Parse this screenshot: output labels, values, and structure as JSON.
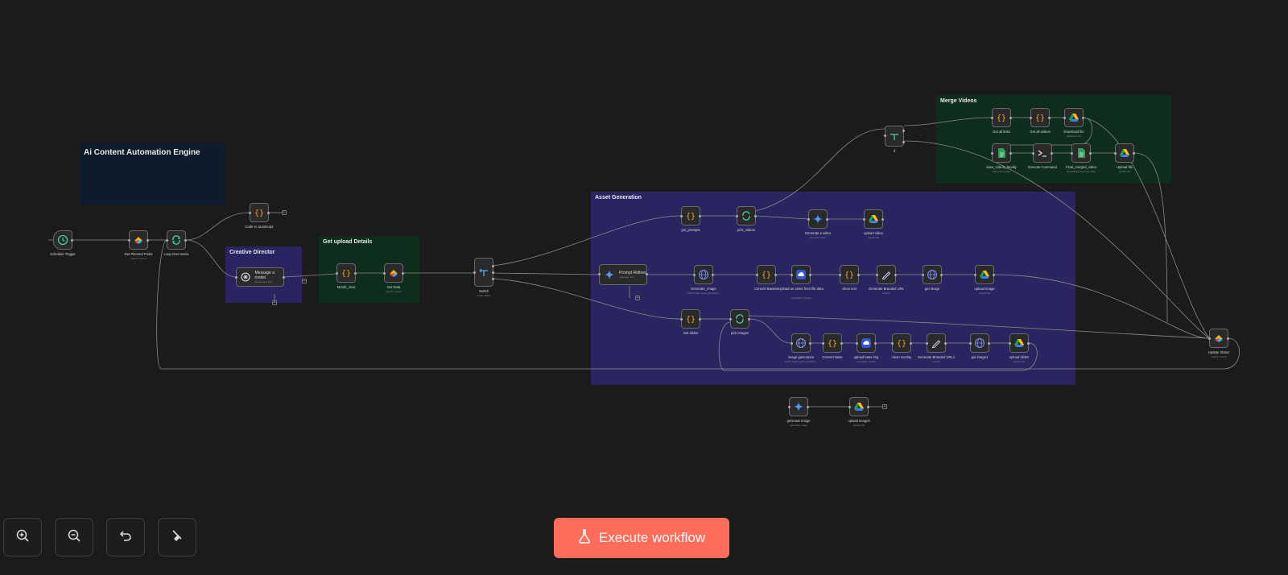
{
  "canvas": {
    "background": "#1b1b1b",
    "execute_label": "Execute workflow",
    "execute_color": "#ff6d5a"
  },
  "controls": [
    {
      "name": "zoom-in-button",
      "icon": "zoom-in-icon"
    },
    {
      "name": "zoom-out-button",
      "icon": "zoom-out-icon"
    },
    {
      "name": "undo-button",
      "icon": "undo-icon"
    },
    {
      "name": "tidy-up-button",
      "icon": "broom-icon"
    }
  ],
  "sticky_notes": [
    {
      "id": "engine",
      "title": "Ai Content Automation Engine",
      "color": "#0d1b2a"
    },
    {
      "id": "creative",
      "title": "Creative Director",
      "color": "#2a2560"
    },
    {
      "id": "upload",
      "title": "Get upload Details",
      "color": "#0f2d1c"
    },
    {
      "id": "asset",
      "title": "Asset Generation",
      "color": "#2a2560"
    },
    {
      "id": "merge",
      "title": "Merge Videos",
      "color": "#0f2d1c"
    }
  ],
  "nodes": [
    {
      "id": "trigger",
      "label": "Schedule Trigger",
      "sub": "",
      "icon": "clock-icon"
    },
    {
      "id": "getplanned",
      "label": "Get Planned Posts",
      "sub": "search: record",
      "icon": "airtable-icon"
    },
    {
      "id": "loop",
      "label": "Loop Over Items",
      "sub": "",
      "icon": "loop-icon"
    },
    {
      "id": "codejs",
      "label": "Code in JavaScript",
      "sub": "",
      "icon": "code-icon"
    },
    {
      "id": "month",
      "label": "Month_Year",
      "sub": "",
      "icon": "code-icon"
    },
    {
      "id": "getdata",
      "label": "Get Data",
      "sub": "search: record",
      "icon": "airtable-icon"
    },
    {
      "id": "switch",
      "label": "Switch",
      "sub": "mode: Rules",
      "icon": "switch-icon"
    },
    {
      "id": "getprompts",
      "label": "get_prompts",
      "sub": "",
      "icon": "code-icon"
    },
    {
      "id": "pickvideos",
      "label": "pick_videos",
      "sub": "",
      "icon": "loop-icon"
    },
    {
      "id": "genvideo",
      "label": "Generate a video",
      "sub": "generate: video",
      "icon": "gemini-icon"
    },
    {
      "id": "uploadvideo",
      "label": "upload video",
      "sub": "upload: file",
      "icon": "drive-icon"
    },
    {
      "id": "genimage",
      "label": "Generate_Image",
      "sub": "POST: https://generativelang...",
      "icon": "http-icon"
    },
    {
      "id": "convb64",
      "label": "Convert Base64",
      "sub": "",
      "icon": "code-icon"
    },
    {
      "id": "uploadasset",
      "label": "Upload an asset from file data",
      "sub": "uploadFile: upload",
      "icon": "cloud-icon"
    },
    {
      "id": "cleantext",
      "label": "clean text",
      "sub": "",
      "icon": "code-icon"
    },
    {
      "id": "branded",
      "label": "Generate Branded URL",
      "sub": "convert",
      "icon": "pen-icon"
    },
    {
      "id": "getimage",
      "label": "get image",
      "sub": "",
      "icon": "http-icon"
    },
    {
      "id": "uploadimage",
      "label": "upload image",
      "sub": "upload: file",
      "icon": "drive-icon"
    },
    {
      "id": "getslides",
      "label": "Get slides",
      "sub": "",
      "icon": "code-icon"
    },
    {
      "id": "pickimages",
      "label": "pick images",
      "sub": "",
      "icon": "loop-icon"
    },
    {
      "id": "imggen",
      "label": "image generation",
      "sub": "POST: https://generativelang...",
      "icon": "http-icon"
    },
    {
      "id": "convbase",
      "label": "Convert Base",
      "sub": "",
      "icon": "code-icon"
    },
    {
      "id": "uploadbase",
      "label": "upload base img",
      "sub": "uploadFile: upload",
      "icon": "cloud-icon"
    },
    {
      "id": "cleanoverlay",
      "label": "clean overlay",
      "sub": "",
      "icon": "code-icon"
    },
    {
      "id": "branded1",
      "label": "Generate Branded URL1",
      "sub": "convert",
      "icon": "pen-icon"
    },
    {
      "id": "getimage1",
      "label": "get image1",
      "sub": "",
      "icon": "http-icon"
    },
    {
      "id": "uploadslides",
      "label": "upload slides",
      "sub": "upload: file",
      "icon": "drive-icon"
    },
    {
      "id": "if",
      "label": "If",
      "sub": "",
      "icon": "switch-icon"
    },
    {
      "id": "getalllinks",
      "label": "Get all links",
      "sub": "",
      "icon": "code-icon"
    },
    {
      "id": "getallvideos",
      "label": "Get all videos",
      "sub": "",
      "icon": "code-icon"
    },
    {
      "id": "download",
      "label": "Download file",
      "sub": "download: file",
      "icon": "drive-icon"
    },
    {
      "id": "savevideos",
      "label": "save_videos_locally",
      "sub": "Write File to Disk",
      "icon": "file-icon"
    },
    {
      "id": "execcmd",
      "label": "Execute Command",
      "sub": "",
      "icon": "terminal-icon"
    },
    {
      "id": "finalmerged",
      "label": "Final_merged_video",
      "sub": "Read/Write Files from Disk",
      "icon": "file-icon"
    },
    {
      "id": "uploadfile",
      "label": "Upload file",
      "sub": "upload: file",
      "icon": "drive-icon"
    },
    {
      "id": "updatestatus",
      "label": "Update Status",
      "sub": "update: record",
      "icon": "airtable-icon"
    },
    {
      "id": "genimage2",
      "label": "generate image",
      "sub": "generate: image",
      "icon": "gemini-icon"
    },
    {
      "id": "uploadimages",
      "label": "upload images",
      "sub": "upload: file",
      "icon": "drive-icon"
    }
  ],
  "wide_nodes": [
    {
      "id": "message",
      "label": "Message a model",
      "sub": "Responses Text",
      "icon": "openai-icon"
    },
    {
      "id": "refiner",
      "label": "Prompt Refiner",
      "sub": "message: text",
      "icon": "gemini-icon"
    }
  ]
}
